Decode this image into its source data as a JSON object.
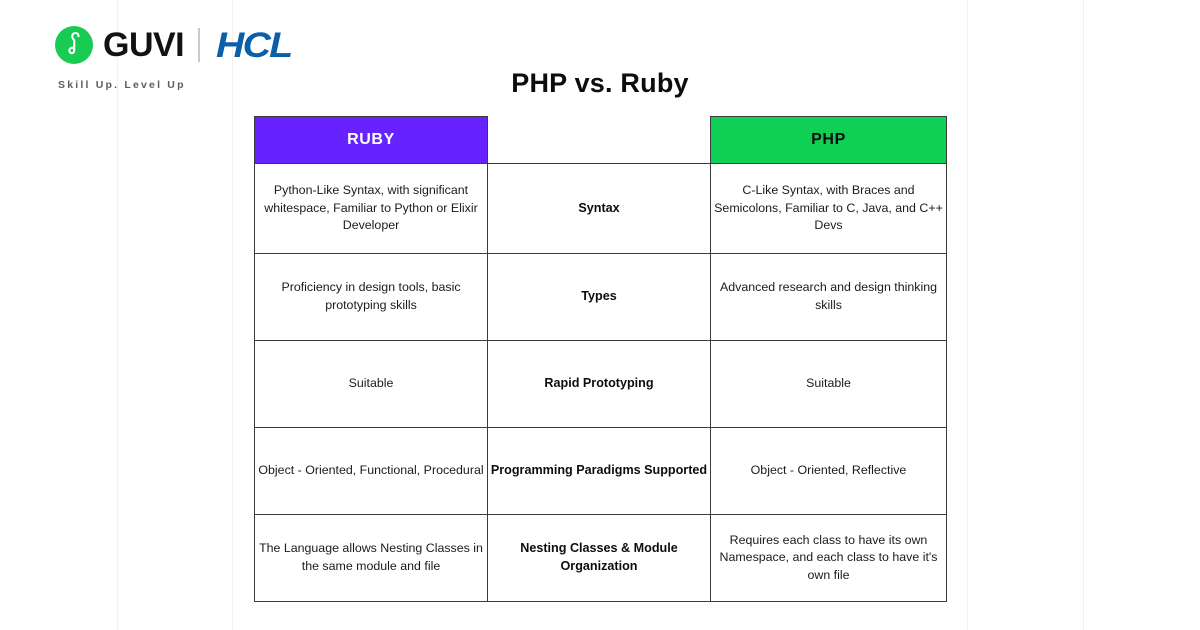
{
  "brand": {
    "logo_icon": "guvi-circle-logo",
    "name": "GUVI",
    "partner": "HCL",
    "tagline": "Skill Up. Level Up",
    "colors": {
      "guvi_green": "#18cb53",
      "hcl_blue": "#0a5fa8"
    }
  },
  "page": {
    "title": "PHP vs. Ruby"
  },
  "table": {
    "headers": {
      "left": "RUBY",
      "middle": "",
      "right": "PHP"
    },
    "header_colors": {
      "left_bg": "#6622ff",
      "left_text": "#ffffff",
      "right_bg": "#0fd055",
      "right_text": "#0d0d0d"
    },
    "rows": [
      {
        "left": "Python-Like Syntax, with significant whitespace, Familiar to Python or Elixir Developer",
        "feature": "Syntax",
        "right": "C-Like Syntax, with Braces and Semicolons, Familiar to C, Java, and C++ Devs"
      },
      {
        "left": "Proficiency in design tools, basic prototyping skills",
        "feature": "Types",
        "right": "Advanced research and design thinking skills"
      },
      {
        "left": "Suitable",
        "feature": "Rapid Prototyping",
        "right": "Suitable"
      },
      {
        "left": "Object - Oriented, Functional, Procedural",
        "feature": "Programming Paradigms Supported",
        "right": "Object - Oriented, Reflective"
      },
      {
        "left": "The Language allows Nesting Classes in the same module and file",
        "feature": "Nesting Classes & Module Organization",
        "right": "Requires each class to have its own Namespace, and each class to have it's own file"
      }
    ]
  }
}
